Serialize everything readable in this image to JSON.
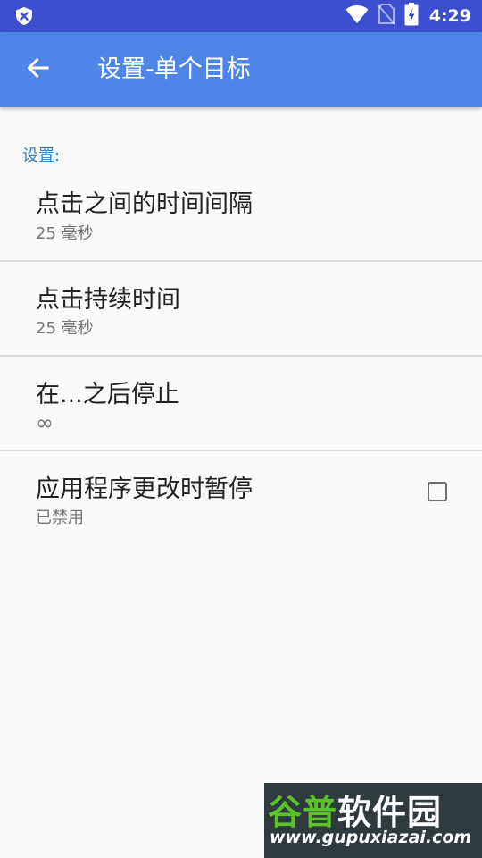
{
  "status_bar": {
    "time": "4:29",
    "icons": [
      "shield-close-icon",
      "wifi-icon",
      "no-sim-icon",
      "battery-charging-icon"
    ],
    "background": "#3b4fcf"
  },
  "app_bar": {
    "title": "设置-单个目标",
    "back_icon": "arrow-back-icon",
    "background": "#4e86e8"
  },
  "settings": {
    "section_header": "设置:",
    "header_color": "#3a7fbd",
    "items": [
      {
        "title": "点击之间的时间间隔",
        "summary": "25 毫秒"
      },
      {
        "title": "点击持续时间",
        "summary": "25 毫秒"
      },
      {
        "title": "在...之后停止",
        "summary": "∞"
      },
      {
        "title": "应用程序更改时暂停",
        "summary": "已禁用",
        "checkbox": false
      }
    ]
  },
  "watermark": {
    "logo_part1": "谷普",
    "logo_part2": "软件园",
    "url": "www.gupuxiazai.com"
  }
}
